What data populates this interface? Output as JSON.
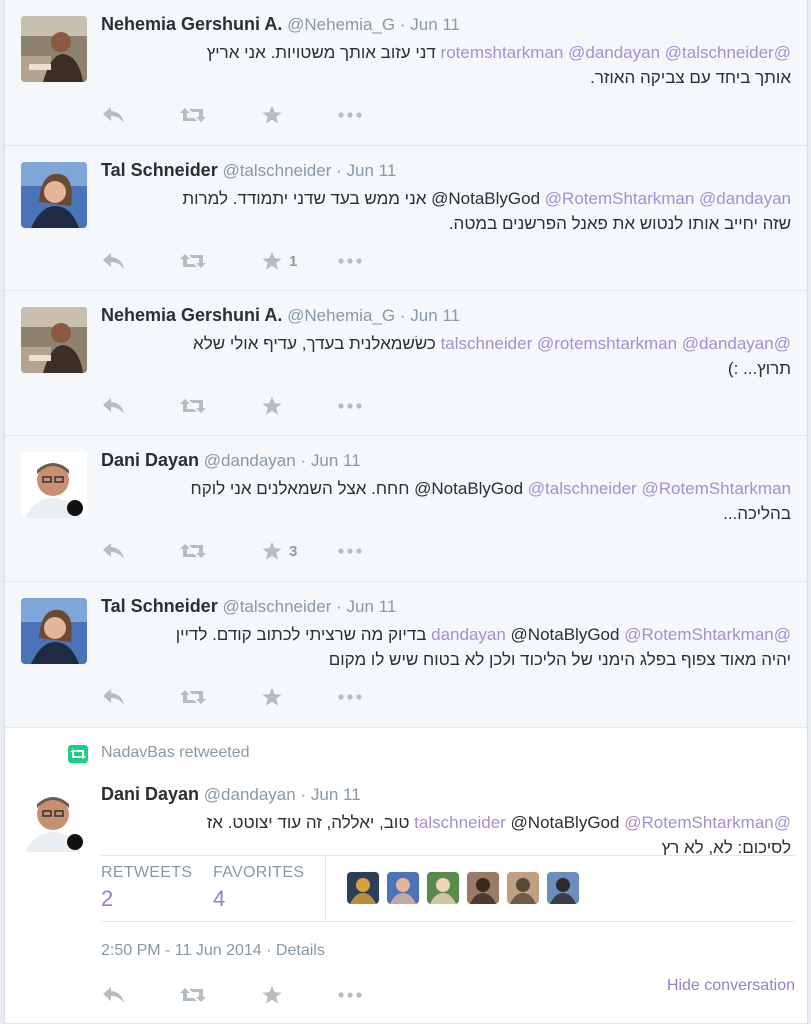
{
  "tweets": [
    {
      "name": "Nehemia Gershuni A.",
      "handle": "@Nehemia_G",
      "separator": "·",
      "time": "Jun 11",
      "line1": [
        {
          "t": "@rotemshtarkman",
          "m": true
        },
        {
          "t": " "
        },
        {
          "t": "@dandayan",
          "m": true
        },
        {
          "t": " "
        },
        {
          "t": "@talschneider",
          "m": true
        },
        {
          "t": " דני עזוב אותך משטויות. אני אריץ"
        }
      ],
      "line2": "אותך ביחד עם צביקה האוזר.",
      "favorites": ""
    },
    {
      "name": "Tal Schneider",
      "handle": "@talschneider",
      "separator": "·",
      "time": "Jun 11",
      "line1": [
        {
          "t": "NotaBlyGod "
        },
        {
          "t": "@RotemShtarkman",
          "m": true
        },
        {
          "t": " "
        },
        {
          "t": "@dandayan",
          "m": true
        },
        {
          "t": "@"
        },
        {
          "t": " אני ממש בעד שדני יתמודד. למרות"
        }
      ],
      "line2": "שזה יחייב אותו לנטוש את פאנל הפרשנים במטה.",
      "favorites": "1"
    },
    {
      "name": "Nehemia Gershuni A.",
      "handle": "@Nehemia_G",
      "separator": "·",
      "time": "Jun 11",
      "line1": [
        {
          "t": "@talschneider",
          "m": true
        },
        {
          "t": " "
        },
        {
          "t": "@rotemshtarkman",
          "m": true
        },
        {
          "t": " "
        },
        {
          "t": "@dandayan",
          "m": true
        },
        {
          "t": " כשׂשמאלנית בעדך, עדיף אולי שלא"
        }
      ],
      "line2": "תרוץ... :)",
      "favorites": ""
    },
    {
      "name": "Dani Dayan",
      "handle": "@dandayan",
      "separator": "·",
      "time": "Jun 11",
      "line1": [
        {
          "t": "NotaBlyGod "
        },
        {
          "t": "@talschneider",
          "m": true
        },
        {
          "t": " "
        },
        {
          "t": "@RotemShtarkman",
          "m": true
        },
        {
          "t": "@"
        },
        {
          "t": " חחח. אצל השמאלנים אני לוקח"
        }
      ],
      "line2": "בהליכה...",
      "favorites": "3"
    },
    {
      "name": "Tal Schneider",
      "handle": "@talschneider",
      "separator": "·",
      "time": "Jun 11",
      "line1": [
        {
          "t": "@dandayan",
          "m": true
        },
        {
          "t": " @NotaBlyGod "
        },
        {
          "t": "@RotemShtarkman",
          "m": true
        },
        {
          "t": " בדיוק מה שרציתי לכתוב קודם. לדיין"
        }
      ],
      "line2": "יהיה מאוד צפוף בפלג הימני של הליכוד ולכן לא בטוח שיש לו מקום",
      "favorites": ""
    },
    {
      "name": "Dani Dayan",
      "handle": "@dandayan",
      "separator": "·",
      "time": "Jun 11",
      "line1": [
        {
          "t": "@talschneider",
          "m": true
        },
        {
          "t": " @NotaBlyGod "
        },
        {
          "t": "@RotemShtarkman",
          "m": true
        },
        {
          "t": " טוב, יאללה, זה עוד יצוטט. אז"
        }
      ],
      "line2": "לסיכום: לא, לא רץ",
      "favorites": ""
    }
  ],
  "retweeted_by": "NadavBas retweeted",
  "stats": {
    "retweets_label": "RETWEETS",
    "retweets_value": "2",
    "favorites_label": "FAVORITES",
    "favorites_value": "4"
  },
  "timestamp": "2:50 PM - 11 Jun 2014 · Details",
  "hide_conversation": "Hide conversation",
  "icons": [
    "reply-icon",
    "retweet-icon",
    "favorite-icon",
    "more-icon"
  ],
  "colors": {
    "mention": "#a48fd1",
    "meta": "#8899a6",
    "retweet_badge": "#19cf86"
  }
}
